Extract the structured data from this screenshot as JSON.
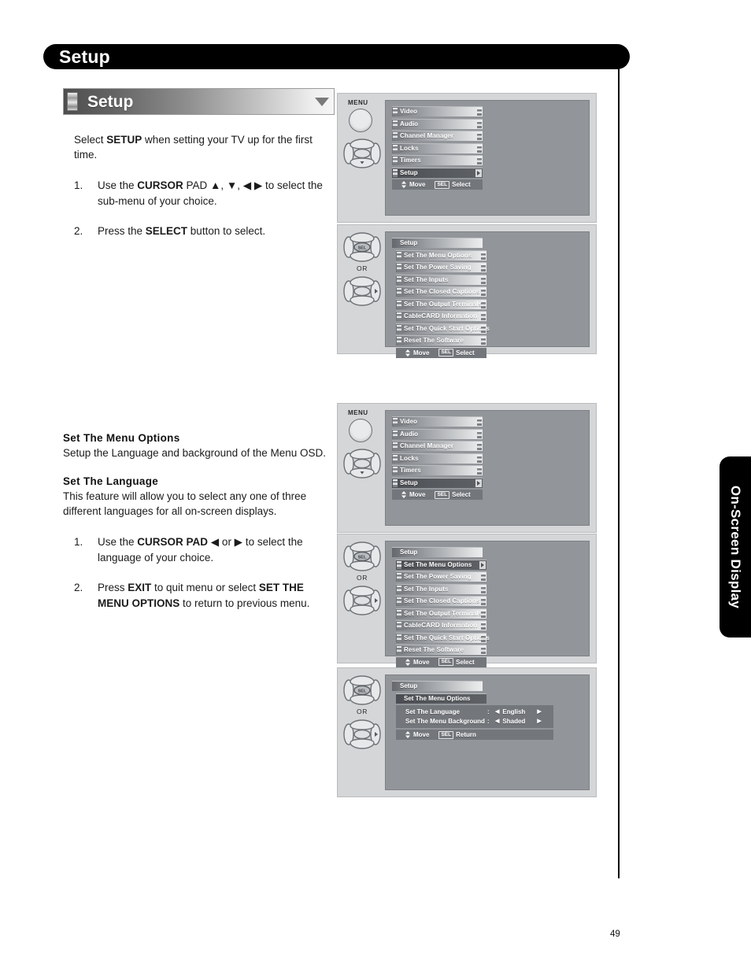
{
  "header": {
    "title": "Setup"
  },
  "section_bar": {
    "title": "Setup"
  },
  "intro": {
    "line_a": "Select ",
    "line_b": "SETUP",
    "line_c": " when setting your TV up for the first time.",
    "steps": [
      {
        "num": "1.",
        "prefix": "Use the ",
        "bold": "CURSOR",
        "mid": " PAD ▲, ▼, ◀    ▶ to select the sub-menu of your choice."
      },
      {
        "num": "2.",
        "prefix": "Press the ",
        "bold": "SELECT",
        "mid": " button to select."
      }
    ]
  },
  "menu_options_section": {
    "heading": "Set The Menu Options",
    "body": "Setup the Language and background of the Menu OSD.",
    "sub_heading": "Set The Language",
    "sub_body": "This feature will allow you to select any one of three different languages for all on-screen displays.",
    "steps": [
      {
        "num": "1.",
        "t1": "Use the ",
        "b1": "CURSOR PAD",
        "t2": " ◀ or ▶ to select the language of your choice."
      },
      {
        "num": "2.",
        "t1": "Press ",
        "b1": "EXIT",
        "t2": " to quit menu or select ",
        "b2": "SET THE MENU OPTIONS",
        "t3": " to return to previous menu."
      }
    ]
  },
  "remote": {
    "menu_label": "MENU",
    "or_label": "OR",
    "sel_label": "SEL"
  },
  "osd": {
    "main_menu": {
      "items": [
        "Video",
        "Audio",
        "Channel Manager",
        "Locks",
        "Timers",
        "Setup"
      ],
      "selected": "Setup",
      "footer": {
        "move": "Move",
        "sel_badge": "SEL",
        "action": "Select"
      }
    },
    "setup_menu": {
      "title": "Setup",
      "items": [
        "Set The Menu Options",
        "Set The Power Saving",
        "Set The Inputs",
        "Set The Closed Captions",
        "Set The Output Terminals",
        "CableCARD Information",
        "Set The Quick Start Options",
        "Reset The Software"
      ],
      "footer": {
        "move": "Move",
        "sel_badge": "SEL",
        "action": "Select"
      }
    },
    "menu_options_screen": {
      "title": "Setup",
      "sub_title": "Set The Menu Options",
      "settings": [
        {
          "name": "Set The Language",
          "colon": ":",
          "left_arrow": "◀",
          "value": "English",
          "right_arrow": "▶"
        },
        {
          "name": "Set The Menu Background",
          "colon": ":",
          "left_arrow": "◀",
          "value": "Shaded",
          "right_arrow": "▶"
        }
      ],
      "footer": {
        "move": "Move",
        "sel_badge": "SEL",
        "action": "Return"
      }
    }
  },
  "side_tab": {
    "label": "On-Screen Display"
  },
  "page_number": "49"
}
